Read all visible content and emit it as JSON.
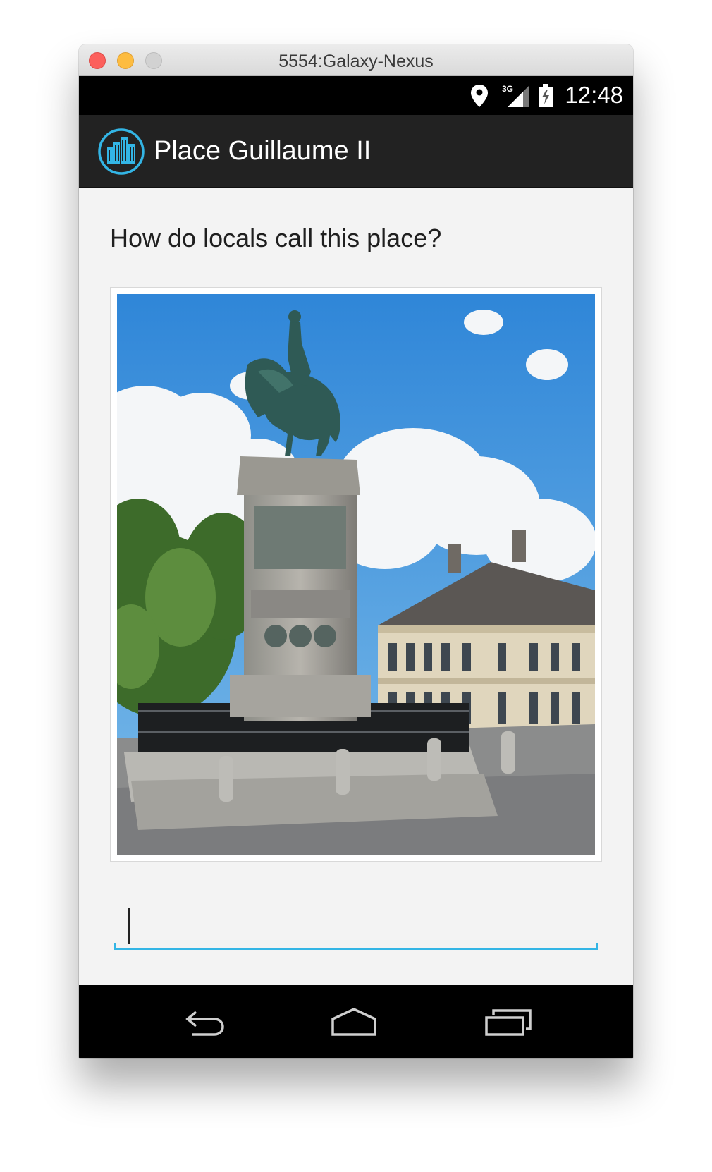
{
  "window": {
    "title": "5554:Galaxy-Nexus"
  },
  "status_bar": {
    "time": "12:48",
    "network": "3G",
    "icons": [
      "location-icon",
      "signal-icon",
      "battery-icon"
    ]
  },
  "action_bar": {
    "title": "Place Guillaume II",
    "logo_icon": "city-buildings-icon"
  },
  "content": {
    "question": "How do locals call this place?",
    "image_subject": "equestrian-statue-photo",
    "answer": {
      "value": "",
      "placeholder": ""
    }
  },
  "nav_bar": {
    "icons": [
      "back-icon",
      "home-icon",
      "recent-apps-icon"
    ]
  },
  "colors": {
    "accent": "#33b5e5",
    "action_bar": "#222222",
    "status_bar": "#000000",
    "background": "#f3f3f3"
  }
}
